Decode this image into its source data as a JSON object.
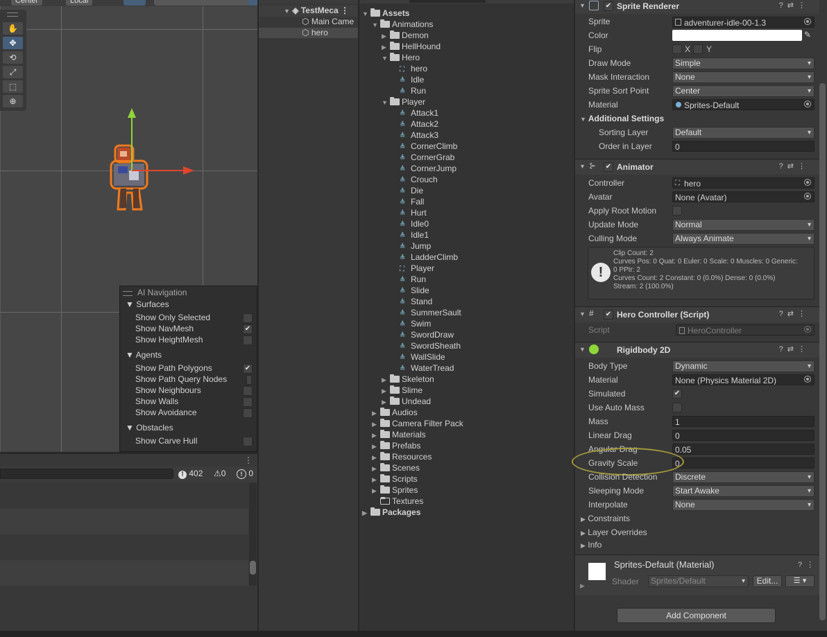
{
  "scene": {
    "pivot_label": "Center",
    "space_label": "Local",
    "tools": [
      "hand-icon",
      "move-icon",
      "rotate-icon",
      "scale-icon",
      "rect-icon",
      "transform-icon"
    ]
  },
  "ai_navigation": {
    "title": "AI Navigation",
    "surfaces": "Surfaces",
    "show_only_selected": "Show Only Selected",
    "show_navmesh": "Show NavMesh",
    "show_heightmesh": "Show HeightMesh",
    "agents": "Agents",
    "show_path_polygons": "Show Path Polygons",
    "show_path_query_nodes": "Show Path Query Nodes",
    "show_neighbours": "Show Neighbours",
    "show_walls": "Show Walls",
    "show_avoidance": "Show Avoidance",
    "obstacles": "Obstacles",
    "show_carve_hull": "Show Carve Hull"
  },
  "console": {
    "warnings_count": "402",
    "errors_a": "0",
    "errors_b": "0"
  },
  "hierarchy": {
    "scene_name": "TestMeca",
    "items": [
      "Main Came",
      "hero"
    ]
  },
  "project": {
    "assets": "Assets",
    "animations": "Animations",
    "demon": "Demon",
    "hellhound": "HellHound",
    "hero": "Hero",
    "hero_items": [
      "hero",
      "Idle",
      "Run"
    ],
    "player": "Player",
    "player_items": [
      "Attack1",
      "Attack2",
      "Attack3",
      "CornerClimb",
      "CornerGrab",
      "CornerJump",
      "Crouch",
      "Die",
      "Fall",
      "Hurt",
      "Idle0",
      "Idle1",
      "Jump",
      "LadderClimb",
      "Player",
      "Run",
      "Slide",
      "Stand",
      "SummerSault",
      "Swim",
      "SwordDraw",
      "SwordSheath",
      "WallSlide",
      "WaterTread"
    ],
    "anim_folders_after": [
      "Skeleton",
      "Slime",
      "Undead"
    ],
    "asset_folders": [
      "Audios",
      "Camera Filter Pack",
      "Materials",
      "Prefabs",
      "Resources",
      "Scenes",
      "Scripts",
      "Sprites",
      "Textures"
    ],
    "packages": "Packages"
  },
  "inspector": {
    "sprite_renderer": {
      "title": "Sprite Renderer",
      "sprite_label": "Sprite",
      "sprite_value": "adventurer-idle-00-1.3",
      "color_label": "Color",
      "flip_label": "Flip",
      "flip_x": "X",
      "flip_y": "Y",
      "draw_mode_label": "Draw Mode",
      "draw_mode": "Simple",
      "mask_label": "Mask Interaction",
      "mask": "None",
      "sort_point_label": "Sprite Sort Point",
      "sort_point": "Center",
      "material_label": "Material",
      "material": "Sprites-Default",
      "additional": "Additional Settings",
      "sorting_layer_label": "Sorting Layer",
      "sorting_layer": "Default",
      "order_label": "Order in Layer",
      "order": "0"
    },
    "animator": {
      "title": "Animator",
      "controller_label": "Controller",
      "controller": "hero",
      "avatar_label": "Avatar",
      "avatar": "None (Avatar)",
      "root_motion_label": "Apply Root Motion",
      "update_mode_label": "Update Mode",
      "update_mode": "Normal",
      "culling_label": "Culling Mode",
      "culling": "Always Animate",
      "info_lines": [
        "Clip Count: 2",
        "Curves Pos: 0 Quat: 0 Euler: 0 Scale: 0 Muscles: 0 Generic:",
        "0 PPtr: 2",
        "Curves Count: 2 Constant: 0 (0.0%) Dense: 0 (0.0%)",
        "Stream: 2 (100.0%)"
      ]
    },
    "hero_controller": {
      "title": "Hero Controller (Script)",
      "script_label": "Script",
      "script": "HeroController"
    },
    "rigidbody": {
      "title": "Rigidbody 2D",
      "body_type_label": "Body Type",
      "body_type": "Dynamic",
      "material_label": "Material",
      "material": "None (Physics Material 2D)",
      "simulated_label": "Simulated",
      "auto_mass_label": "Use Auto Mass",
      "mass_label": "Mass",
      "mass": "1",
      "linear_drag_label": "Linear Drag",
      "linear_drag": "0",
      "angular_drag_label": "Angular Drag",
      "angular_drag": "0.05",
      "gravity_label": "Gravity Scale",
      "gravity": "0",
      "collision_label": "Collision Detection",
      "collision": "Discrete",
      "sleeping_label": "Sleeping Mode",
      "sleeping": "Start Awake",
      "interpolate_label": "Interpolate",
      "interpolate": "None",
      "constraints": "Constraints",
      "layer_overrides": "Layer Overrides",
      "info": "Info"
    },
    "material_preview": {
      "title": "Sprites-Default (Material)",
      "shader_label": "Shader",
      "shader": "Sprites/Default",
      "edit_label": "Edit..."
    },
    "add_component": "Add Component"
  },
  "colors": {
    "highlight_circle": "#a59a3c",
    "selection": "#46607c"
  }
}
